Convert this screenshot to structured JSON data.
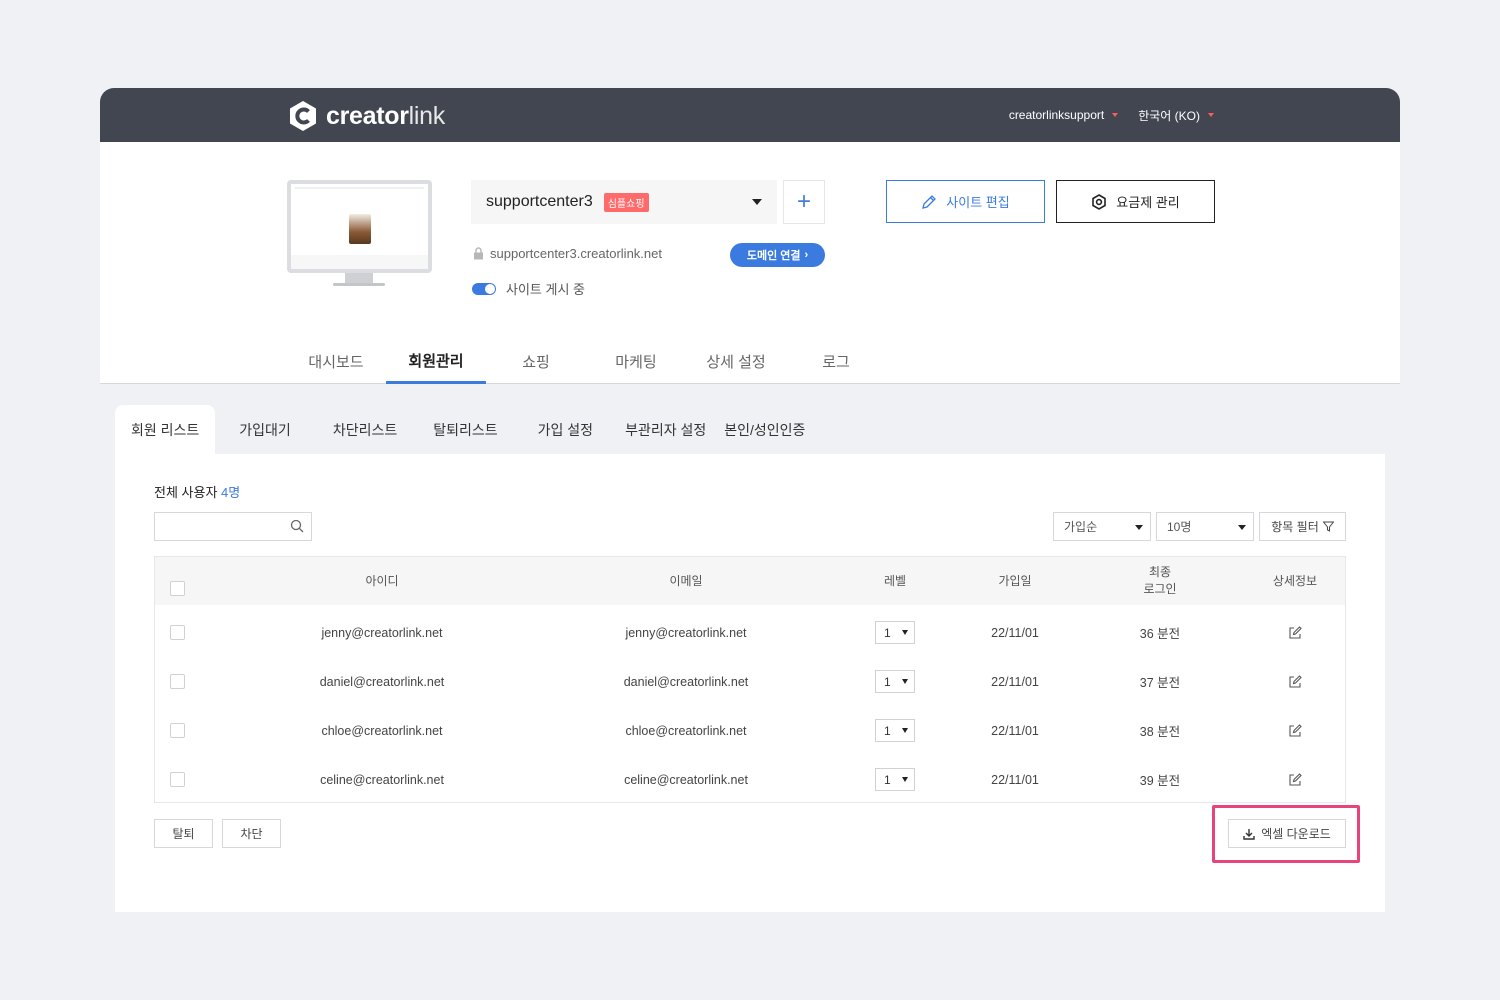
{
  "topbar": {
    "logo_text_a": "creator",
    "logo_text_b": "link",
    "account": "creatorlinksupport",
    "language": "한국어 (KO)"
  },
  "site": {
    "name": "supportcenter3",
    "badge": "심플쇼핑",
    "url": "supportcenter3.creatorlink.net",
    "domain_button": "도메인 연결",
    "publish_status": "사이트 게시 중",
    "publish_on": true,
    "edit_button": "사이트 편집",
    "plan_button": "요금제 관리"
  },
  "main_tabs": [
    {
      "label": "대시보드",
      "active": false
    },
    {
      "label": "회원관리",
      "active": true
    },
    {
      "label": "쇼핑",
      "active": false
    },
    {
      "label": "마케팅",
      "active": false
    },
    {
      "label": "상세 설정",
      "active": false
    },
    {
      "label": "로그",
      "active": false
    }
  ],
  "sub_tabs": [
    {
      "label": "회원 리스트",
      "active": true
    },
    {
      "label": "가입대기",
      "active": false
    },
    {
      "label": "차단리스트",
      "active": false
    },
    {
      "label": "탈퇴리스트",
      "active": false
    },
    {
      "label": "가입 설정",
      "active": false
    },
    {
      "label": "부관리자 설정",
      "active": false
    },
    {
      "label": "본인/성인인증",
      "active": false
    }
  ],
  "members": {
    "total_label": "전체 사용자 ",
    "total_count": "4명",
    "search_placeholder": "",
    "sort_value": "가입순",
    "page_size_value": "10명",
    "filter_button": "항목 필터",
    "columns": {
      "id": "아이디",
      "email": "이메일",
      "level": "레벨",
      "join_date": "가입일",
      "last_login_1": "최종",
      "last_login_2": "로그인",
      "detail": "상세정보"
    },
    "rows": [
      {
        "id": "jenny@creatorlink.net",
        "email": "jenny@creatorlink.net",
        "level": "1",
        "join_date": "22/11/01",
        "last_login": "36 분전"
      },
      {
        "id": "daniel@creatorlink.net",
        "email": "daniel@creatorlink.net",
        "level": "1",
        "join_date": "22/11/01",
        "last_login": "37 분전"
      },
      {
        "id": "chloe@creatorlink.net",
        "email": "chloe@creatorlink.net",
        "level": "1",
        "join_date": "22/11/01",
        "last_login": "38 분전"
      },
      {
        "id": "celine@creatorlink.net",
        "email": "celine@creatorlink.net",
        "level": "1",
        "join_date": "22/11/01",
        "last_login": "39 분전"
      }
    ],
    "withdraw_button": "탈퇴",
    "block_button": "차단",
    "excel_button": "엑셀 다운로드"
  },
  "colors": {
    "topbar": "#414651",
    "accent": "#3b7be0",
    "badge": "#ff6b6b",
    "highlight": "#e8437b"
  }
}
